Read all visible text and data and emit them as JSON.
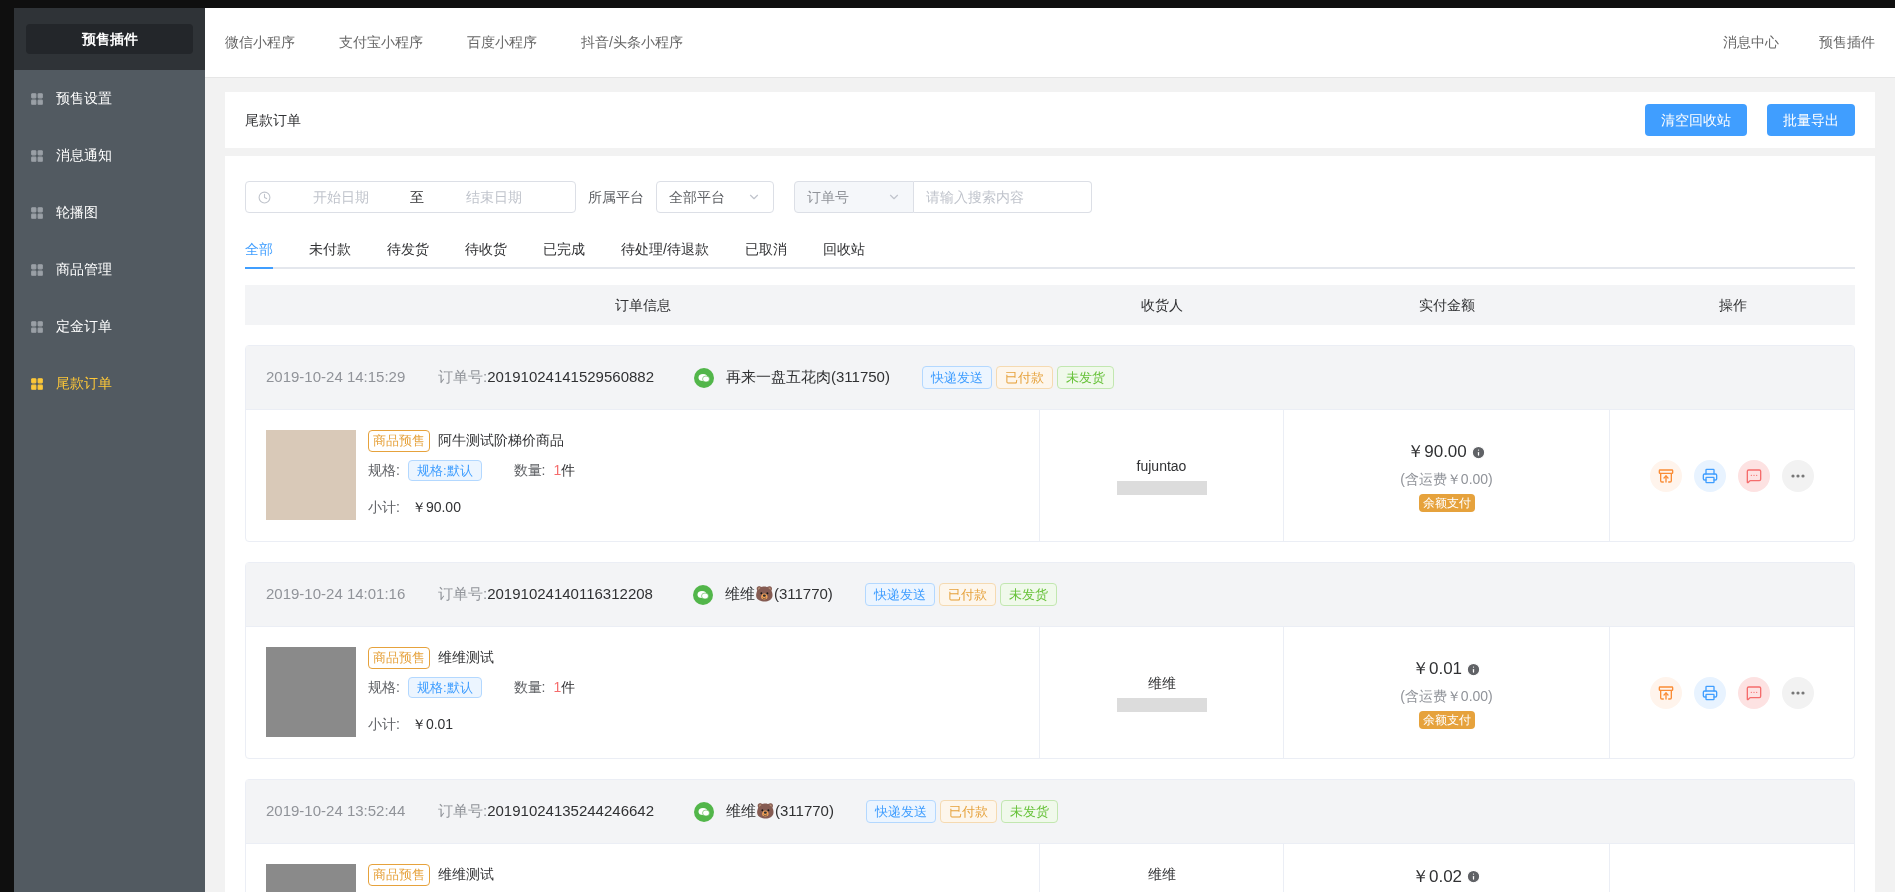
{
  "sidebar": {
    "title": "预售插件",
    "items": [
      {
        "label": "预售设置",
        "selected": false
      },
      {
        "label": "消息通知",
        "selected": false
      },
      {
        "label": "轮播图",
        "selected": false
      },
      {
        "label": "商品管理",
        "selected": false
      },
      {
        "label": "定金订单",
        "selected": false
      },
      {
        "label": "尾款订单",
        "selected": true
      }
    ]
  },
  "topbar": {
    "tabs": [
      "微信小程序",
      "支付宝小程序",
      "百度小程序",
      "抖音/头条小程序"
    ],
    "links": [
      "消息中心",
      "预售插件"
    ]
  },
  "page": {
    "title": "尾款订单",
    "buttons": [
      "清空回收站",
      "批量导出"
    ]
  },
  "filters": {
    "start_placeholder": "开始日期",
    "separator": "至",
    "end_placeholder": "结束日期",
    "platform_label": "所属平台",
    "platform_value": "全部平台",
    "search_type": "订单号",
    "search_placeholder": "请输入搜索内容"
  },
  "status_tabs": [
    {
      "label": "全部",
      "selected": true
    },
    {
      "label": "未付款",
      "selected": false
    },
    {
      "label": "待发货",
      "selected": false
    },
    {
      "label": "待收货",
      "selected": false
    },
    {
      "label": "已完成",
      "selected": false
    },
    {
      "label": "待处理/待退款",
      "selected": false
    },
    {
      "label": "已取消",
      "selected": false
    },
    {
      "label": "回收站",
      "selected": false
    }
  ],
  "table": {
    "columns": [
      "订单信息",
      "收货人",
      "实付金额",
      "操作"
    ]
  },
  "orders": [
    {
      "time": "2019-10-24 14:15:29",
      "order_no_label": "订单号:",
      "order_no": "20191024141529560882",
      "buyer": "再来一盘五花肉(311750)",
      "tags": [
        {
          "kind": "express",
          "label": "快递发送"
        },
        {
          "kind": "paid",
          "label": "已付款"
        },
        {
          "kind": "unshipped",
          "label": "未发货"
        }
      ],
      "product_tag": "商品预售",
      "product": "阿牛测试阶梯价商品",
      "spec_label": "规格:",
      "spec": "规格:默认",
      "qty_label": "数量:",
      "qty": "1",
      "qty_unit": "件",
      "subtotal_label": "小计:",
      "subtotal": "￥90.00",
      "receiver": "fujuntao",
      "amount": "￥90.00",
      "shipping": "(含运费￥0.00)",
      "pay_method": "余额支付"
    },
    {
      "time": "2019-10-24 14:01:16",
      "order_no_label": "订单号:",
      "order_no": "20191024140116312208",
      "buyer": "维维🐻(311770)",
      "tags": [
        {
          "kind": "express",
          "label": "快递发送"
        },
        {
          "kind": "paid",
          "label": "已付款"
        },
        {
          "kind": "unshipped",
          "label": "未发货"
        }
      ],
      "product_tag": "商品预售",
      "product": "维维测试",
      "spec_label": "规格:",
      "spec": "规格:默认",
      "qty_label": "数量:",
      "qty": "1",
      "qty_unit": "件",
      "subtotal_label": "小计:",
      "subtotal": "￥0.01",
      "receiver": "维维",
      "amount": "￥0.01",
      "shipping": "(含运费￥0.00)",
      "pay_method": "余额支付"
    },
    {
      "time": "2019-10-24 13:52:44",
      "order_no_label": "订单号:",
      "order_no": "20191024135244246642",
      "buyer": "维维🐻(311770)",
      "tags": [
        {
          "kind": "express",
          "label": "快递发送"
        },
        {
          "kind": "paid",
          "label": "已付款"
        },
        {
          "kind": "unshipped",
          "label": "未发货"
        }
      ],
      "product_tag": "商品预售",
      "product": "维维测试",
      "receiver": "维维",
      "amount": "￥0.02"
    }
  ]
}
